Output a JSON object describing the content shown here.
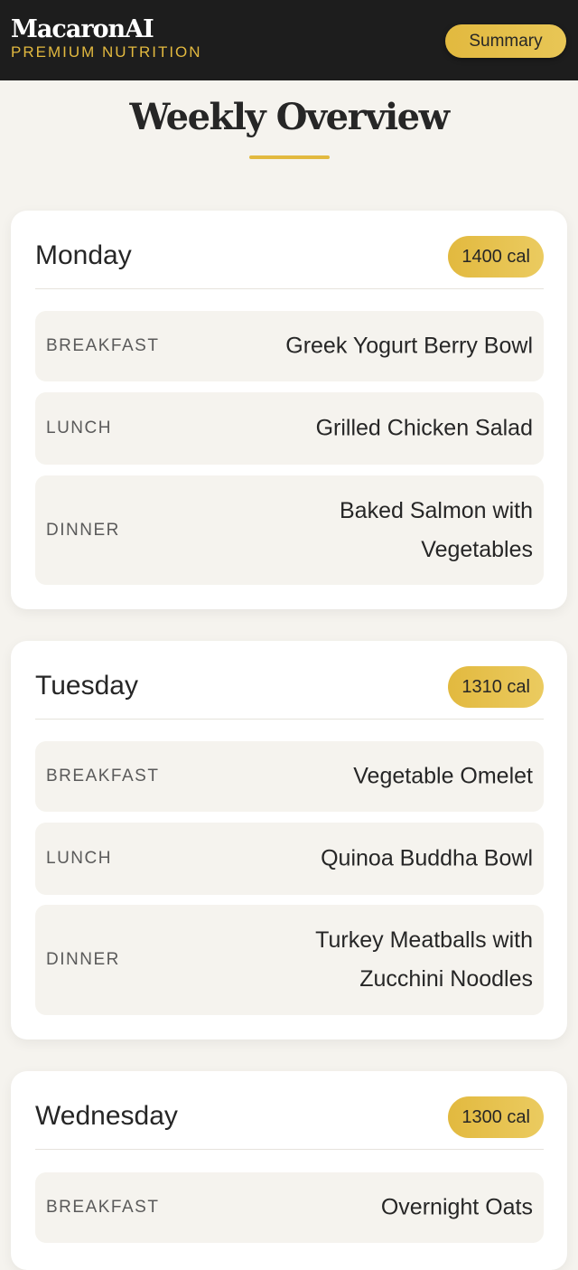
{
  "header": {
    "brand": "MacaronAI",
    "tagline": "PREMIUM NUTRITION",
    "summary_label": "Summary"
  },
  "page": {
    "title": "Weekly Overview"
  },
  "days": [
    {
      "name": "Monday",
      "calories": "1400 cal",
      "meals": [
        {
          "label": "BREAKFAST",
          "dish": "Greek Yogurt Berry Bowl"
        },
        {
          "label": "LUNCH",
          "dish": "Grilled Chicken Salad"
        },
        {
          "label": "DINNER",
          "dish": "Baked Salmon with Vegetables"
        }
      ]
    },
    {
      "name": "Tuesday",
      "calories": "1310 cal",
      "meals": [
        {
          "label": "BREAKFAST",
          "dish": "Vegetable Omelet"
        },
        {
          "label": "LUNCH",
          "dish": "Quinoa Buddha Bowl"
        },
        {
          "label": "DINNER",
          "dish": "Turkey Meatballs with Zucchini Noodles"
        }
      ]
    },
    {
      "name": "Wednesday",
      "calories": "1300 cal",
      "meals": [
        {
          "label": "BREAKFAST",
          "dish": "Overnight Oats"
        }
      ]
    }
  ],
  "colors": {
    "accent": "#e2b93f",
    "header_bg": "#1d1d1d",
    "page_bg": "#f5f3ee",
    "card_bg": "#ffffff",
    "text": "#262626"
  }
}
